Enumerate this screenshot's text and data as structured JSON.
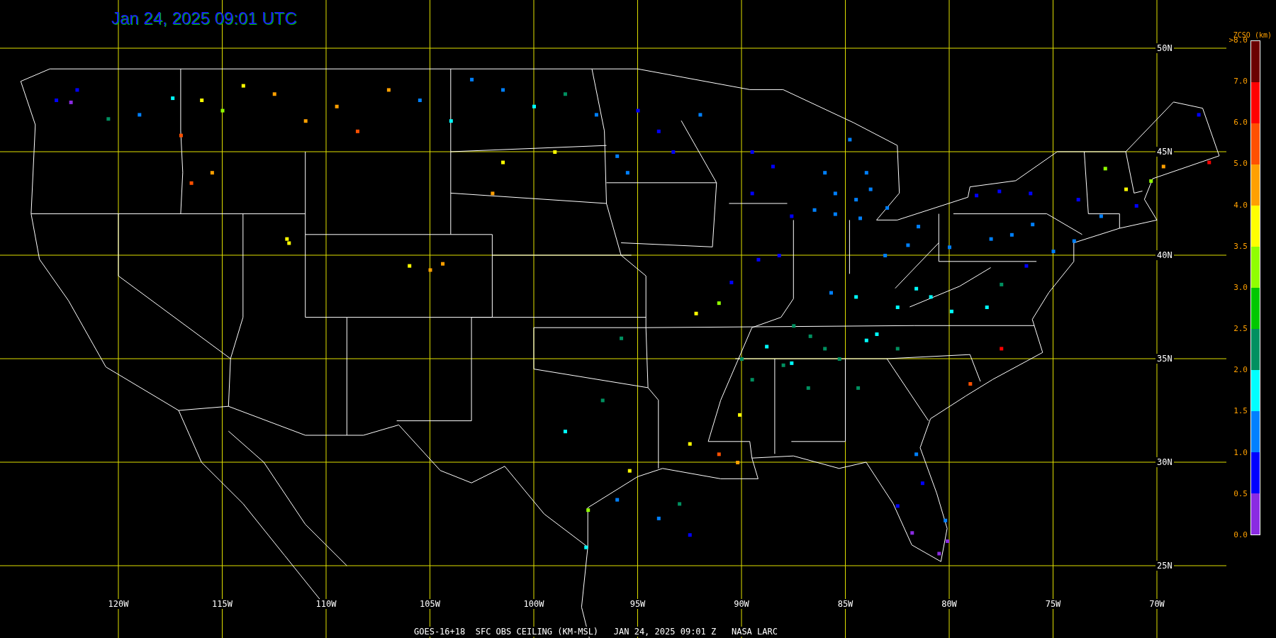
{
  "title": "Jan 24, 2025 09:01 UTC",
  "map": {
    "latitude_labels": [
      "50N",
      "45N",
      "40N",
      "35N",
      "30N",
      "25N"
    ],
    "longitude_labels": [
      "120W",
      "115W",
      "110W",
      "105W",
      "100W",
      "95W",
      "90W",
      "85W",
      "80W",
      "75W",
      "70W"
    ]
  },
  "legend": {
    "title": "ZCSO (km)",
    "labels": [
      ">8.0",
      "7.0",
      "6.0",
      "5.0",
      "4.0",
      "3.5",
      "3.0",
      "2.5",
      "2.0",
      "1.5",
      "1.0",
      "0.5",
      "0.0"
    ],
    "bands": [
      {
        "color": "#6b0000"
      },
      {
        "color": "#ff0000"
      },
      {
        "color": "#ff5000"
      },
      {
        "color": "#ffa000"
      },
      {
        "color": "#ffff00"
      },
      {
        "color": "#90ff00"
      },
      {
        "color": "#00c800"
      },
      {
        "color": "#009060"
      },
      {
        "color": "#00ffff"
      },
      {
        "color": "#0080ff"
      },
      {
        "color": "#0000ff"
      },
      {
        "color": "#8a2be2"
      }
    ]
  },
  "footer": "GOES-16+18  SFC OBS CEILING (KM-MSL)   JAN 24, 2025 09:01 Z   NASA LARC"
}
